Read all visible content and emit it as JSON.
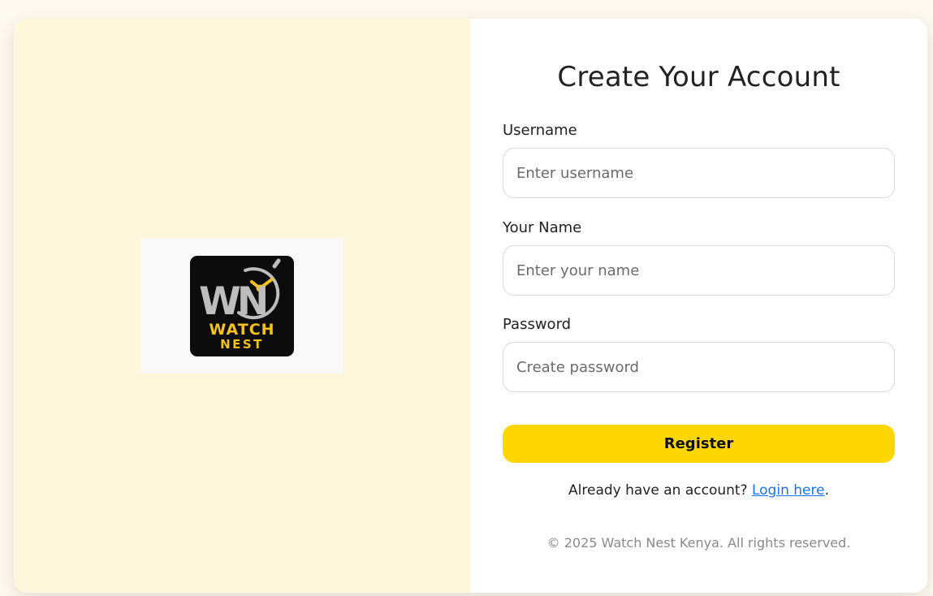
{
  "brand": {
    "logo_initials": "WN",
    "logo_line1": "WATCH",
    "logo_line2": "NEST",
    "accent_color": "#ffd700",
    "logo_gold": "#f4c21e"
  },
  "form": {
    "title": "Create Your Account",
    "username": {
      "label": "Username",
      "placeholder": "Enter username",
      "value": ""
    },
    "name": {
      "label": "Your Name",
      "placeholder": "Enter your name",
      "value": ""
    },
    "password": {
      "label": "Password",
      "placeholder": "Create password",
      "value": ""
    },
    "submit_label": "Register",
    "login_prompt": "Already have an account?",
    "login_link_label": "Login here",
    "login_suffix": "."
  },
  "footer": {
    "copyright": "© 2025 Watch Nest Kenya. All rights reserved."
  },
  "colors": {
    "page_background": "#fffaf0",
    "left_panel": "#fff7dc",
    "link": "#1a73e8",
    "muted_text": "#8a8a8a"
  }
}
